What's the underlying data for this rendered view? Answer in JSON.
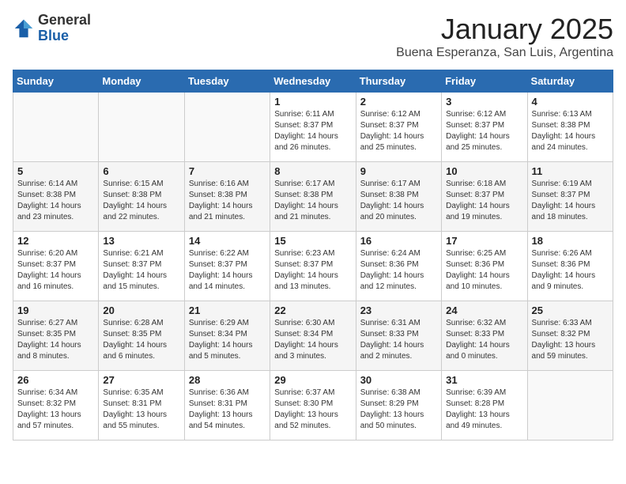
{
  "logo": {
    "general": "General",
    "blue": "Blue"
  },
  "title": "January 2025",
  "location": "Buena Esperanza, San Luis, Argentina",
  "weekdays": [
    "Sunday",
    "Monday",
    "Tuesday",
    "Wednesday",
    "Thursday",
    "Friday",
    "Saturday"
  ],
  "weeks": [
    [
      {
        "day": "",
        "info": ""
      },
      {
        "day": "",
        "info": ""
      },
      {
        "day": "",
        "info": ""
      },
      {
        "day": "1",
        "info": "Sunrise: 6:11 AM\nSunset: 8:37 PM\nDaylight: 14 hours and 26 minutes."
      },
      {
        "day": "2",
        "info": "Sunrise: 6:12 AM\nSunset: 8:37 PM\nDaylight: 14 hours and 25 minutes."
      },
      {
        "day": "3",
        "info": "Sunrise: 6:12 AM\nSunset: 8:37 PM\nDaylight: 14 hours and 25 minutes."
      },
      {
        "day": "4",
        "info": "Sunrise: 6:13 AM\nSunset: 8:38 PM\nDaylight: 14 hours and 24 minutes."
      }
    ],
    [
      {
        "day": "5",
        "info": "Sunrise: 6:14 AM\nSunset: 8:38 PM\nDaylight: 14 hours and 23 minutes."
      },
      {
        "day": "6",
        "info": "Sunrise: 6:15 AM\nSunset: 8:38 PM\nDaylight: 14 hours and 22 minutes."
      },
      {
        "day": "7",
        "info": "Sunrise: 6:16 AM\nSunset: 8:38 PM\nDaylight: 14 hours and 21 minutes."
      },
      {
        "day": "8",
        "info": "Sunrise: 6:17 AM\nSunset: 8:38 PM\nDaylight: 14 hours and 21 minutes."
      },
      {
        "day": "9",
        "info": "Sunrise: 6:17 AM\nSunset: 8:38 PM\nDaylight: 14 hours and 20 minutes."
      },
      {
        "day": "10",
        "info": "Sunrise: 6:18 AM\nSunset: 8:37 PM\nDaylight: 14 hours and 19 minutes."
      },
      {
        "day": "11",
        "info": "Sunrise: 6:19 AM\nSunset: 8:37 PM\nDaylight: 14 hours and 18 minutes."
      }
    ],
    [
      {
        "day": "12",
        "info": "Sunrise: 6:20 AM\nSunset: 8:37 PM\nDaylight: 14 hours and 16 minutes."
      },
      {
        "day": "13",
        "info": "Sunrise: 6:21 AM\nSunset: 8:37 PM\nDaylight: 14 hours and 15 minutes."
      },
      {
        "day": "14",
        "info": "Sunrise: 6:22 AM\nSunset: 8:37 PM\nDaylight: 14 hours and 14 minutes."
      },
      {
        "day": "15",
        "info": "Sunrise: 6:23 AM\nSunset: 8:37 PM\nDaylight: 14 hours and 13 minutes."
      },
      {
        "day": "16",
        "info": "Sunrise: 6:24 AM\nSunset: 8:36 PM\nDaylight: 14 hours and 12 minutes."
      },
      {
        "day": "17",
        "info": "Sunrise: 6:25 AM\nSunset: 8:36 PM\nDaylight: 14 hours and 10 minutes."
      },
      {
        "day": "18",
        "info": "Sunrise: 6:26 AM\nSunset: 8:36 PM\nDaylight: 14 hours and 9 minutes."
      }
    ],
    [
      {
        "day": "19",
        "info": "Sunrise: 6:27 AM\nSunset: 8:35 PM\nDaylight: 14 hours and 8 minutes."
      },
      {
        "day": "20",
        "info": "Sunrise: 6:28 AM\nSunset: 8:35 PM\nDaylight: 14 hours and 6 minutes."
      },
      {
        "day": "21",
        "info": "Sunrise: 6:29 AM\nSunset: 8:34 PM\nDaylight: 14 hours and 5 minutes."
      },
      {
        "day": "22",
        "info": "Sunrise: 6:30 AM\nSunset: 8:34 PM\nDaylight: 14 hours and 3 minutes."
      },
      {
        "day": "23",
        "info": "Sunrise: 6:31 AM\nSunset: 8:33 PM\nDaylight: 14 hours and 2 minutes."
      },
      {
        "day": "24",
        "info": "Sunrise: 6:32 AM\nSunset: 8:33 PM\nDaylight: 14 hours and 0 minutes."
      },
      {
        "day": "25",
        "info": "Sunrise: 6:33 AM\nSunset: 8:32 PM\nDaylight: 13 hours and 59 minutes."
      }
    ],
    [
      {
        "day": "26",
        "info": "Sunrise: 6:34 AM\nSunset: 8:32 PM\nDaylight: 13 hours and 57 minutes."
      },
      {
        "day": "27",
        "info": "Sunrise: 6:35 AM\nSunset: 8:31 PM\nDaylight: 13 hours and 55 minutes."
      },
      {
        "day": "28",
        "info": "Sunrise: 6:36 AM\nSunset: 8:31 PM\nDaylight: 13 hours and 54 minutes."
      },
      {
        "day": "29",
        "info": "Sunrise: 6:37 AM\nSunset: 8:30 PM\nDaylight: 13 hours and 52 minutes."
      },
      {
        "day": "30",
        "info": "Sunrise: 6:38 AM\nSunset: 8:29 PM\nDaylight: 13 hours and 50 minutes."
      },
      {
        "day": "31",
        "info": "Sunrise: 6:39 AM\nSunset: 8:28 PM\nDaylight: 13 hours and 49 minutes."
      },
      {
        "day": "",
        "info": ""
      }
    ]
  ]
}
